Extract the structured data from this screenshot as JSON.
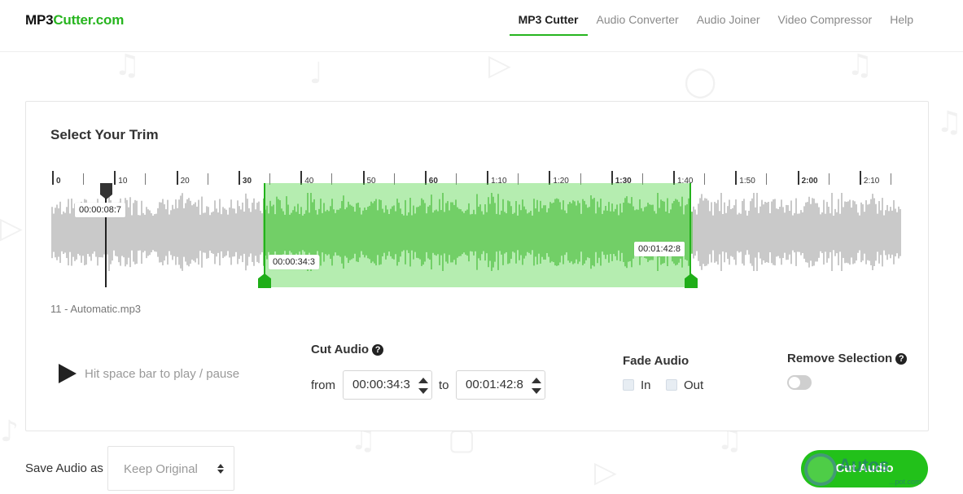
{
  "header": {
    "logo_main": "MP3",
    "logo_accent": "Cutter.com",
    "nav": [
      {
        "label": "MP3 Cutter",
        "active": true
      },
      {
        "label": "Audio Converter",
        "active": false
      },
      {
        "label": "Audio Joiner",
        "active": false
      },
      {
        "label": "Video Compressor",
        "active": false
      },
      {
        "label": "Help",
        "active": false
      }
    ]
  },
  "editor": {
    "title": "Select Your Trim",
    "timeline_labels": [
      "0",
      "10",
      "20",
      "30",
      "40",
      "50",
      "60",
      "1:10",
      "1:20",
      "1:30",
      "1:40",
      "1:50",
      "2:00",
      "2:10"
    ],
    "playhead_time": "00:00:08:7",
    "selection_start_time": "00:00:34:3",
    "selection_end_time": "00:01:42:8",
    "file_name": "11 - Automatic.mp3"
  },
  "controls": {
    "play_hint": "Hit space bar to play / pause",
    "cut_audio_label": "Cut Audio",
    "from_label": "from",
    "to_label": "to",
    "from_value": "00:00:34:3",
    "to_value": "00:01:42:8",
    "fade_label": "Fade Audio",
    "fade_in_label": "In",
    "fade_out_label": "Out",
    "remove_selection_label": "Remove Selection",
    "help_glyph": "?"
  },
  "footer": {
    "save_label": "Save Audio as",
    "save_value": "Keep Original",
    "cut_button": "Cut Audio"
  },
  "watermark": {
    "text": "Autos",
    "sub": "...pot.com"
  },
  "colors": {
    "accent": "#27b51f",
    "selection": "#5bd650",
    "waveform": "#c9c9c9",
    "waveform_selected": "#86c97a"
  },
  "icons": {
    "play": "play-icon",
    "help": "question-circle-icon",
    "playhead": "playhead-marker-icon",
    "handle": "trim-handle-icon"
  }
}
